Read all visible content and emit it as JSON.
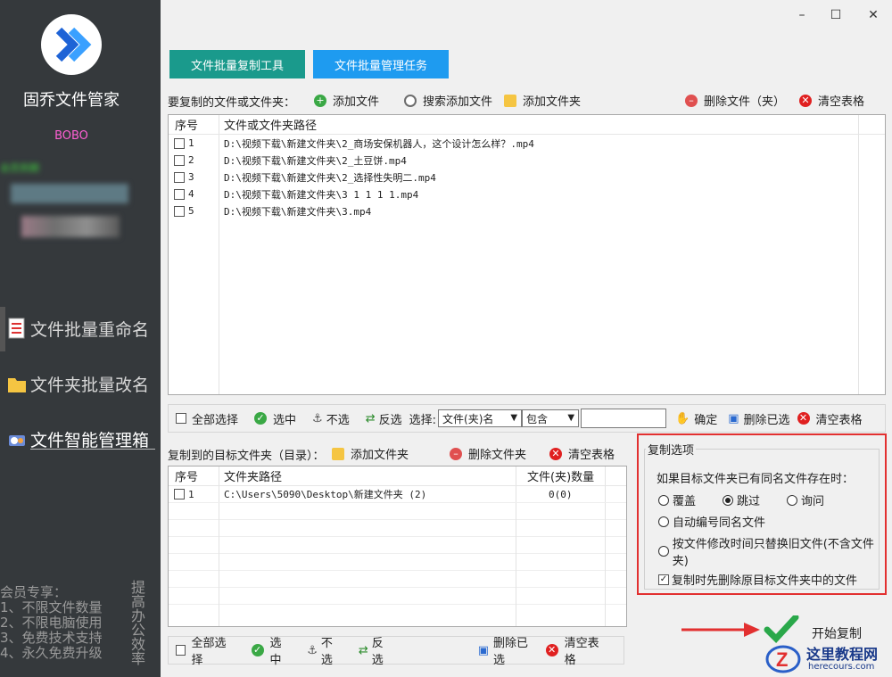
{
  "window": {
    "minimize": "–",
    "maximize": "☐",
    "close": "✕"
  },
  "sidebar": {
    "app_name": "固乔文件管家",
    "user_name": "BOBO",
    "member_label": "会员到期",
    "nav": [
      {
        "label": "文件批量重命名",
        "icon": "document-list-icon"
      },
      {
        "label": "文件夹批量改名",
        "icon": "folder-icon"
      },
      {
        "label": "文件智能管理箱",
        "icon": "toolbox-icon"
      }
    ],
    "promo_lines": [
      "会员专享：",
      "1、不限文件数量",
      "2、不限电脑使用",
      "3、免费技术支持",
      "4、永久免费升级"
    ],
    "promo_side": "提高办公效率"
  },
  "tabs": [
    "文件批量复制工具",
    "文件批量管理任务"
  ],
  "source": {
    "label": "要复制的文件或文件夹：",
    "add_file": "添加文件",
    "search_add": "搜索添加文件",
    "add_folder": "添加文件夹",
    "delete": "删除文件（夹）",
    "clear": "清空表格",
    "col_no": "序号",
    "col_path": "文件或文件夹路径",
    "rows": [
      {
        "no": "1",
        "path": "D:\\视频下载\\新建文件夹\\2_商场安保机器人，这个设计怎么样？.mp4"
      },
      {
        "no": "2",
        "path": "D:\\视频下载\\新建文件夹\\2_土豆饼.mp4"
      },
      {
        "no": "3",
        "path": "D:\\视频下载\\新建文件夹\\2_选择性失明二.mp4"
      },
      {
        "no": "4",
        "path": "D:\\视频下载\\新建文件夹\\3 1 1 1 1.mp4"
      },
      {
        "no": "5",
        "path": "D:\\视频下载\\新建文件夹\\3.mp4"
      }
    ]
  },
  "sel_bar": {
    "select_all": "全部选择",
    "check": "选中",
    "uncheck": "不选",
    "invert": "反选",
    "select_label": "选择:",
    "field": "文件(夹)名",
    "mode": "包含",
    "value": "",
    "confirm": "确定",
    "delete_checked": "删除已选",
    "clear": "清空表格"
  },
  "target": {
    "label": "复制到的目标文件夹（目录）：",
    "add_folder": "添加文件夹",
    "delete_folder": "删除文件夹",
    "clear": "清空表格",
    "col_no": "序号",
    "col_path": "文件夹路径",
    "col_count": "文件(夹)数量",
    "rows": [
      {
        "no": "1",
        "path": "C:\\Users\\5090\\Desktop\\新建文件夹 (2)",
        "count": "0(0)"
      }
    ]
  },
  "target_bar": {
    "select_all": "全部选择",
    "check": "选中",
    "uncheck": "不选",
    "invert": "反选",
    "delete_checked": "删除已选",
    "clear": "清空表格"
  },
  "options": {
    "title": "复制选项",
    "question": "如果目标文件夹已有同名文件存在时：",
    "overwrite": "覆盖",
    "skip": "跳过",
    "ask": "询问",
    "auto_number": "自动编号同名文件",
    "by_time": "按文件修改时间只替换旧文件(不含文件夹)",
    "delete_first": "复制时先删除原目标文件夹中的文件",
    "selected": "skip",
    "delete_first_checked": true
  },
  "start_button": "开始复制",
  "watermark": {
    "name": "这里教程网",
    "url": "herecours.com"
  },
  "colors": {
    "sidebar": "#35393c",
    "tab_teal": "#1a9a8c",
    "tab_blue": "#1e9bf0",
    "highlight_red": "#e23030"
  }
}
